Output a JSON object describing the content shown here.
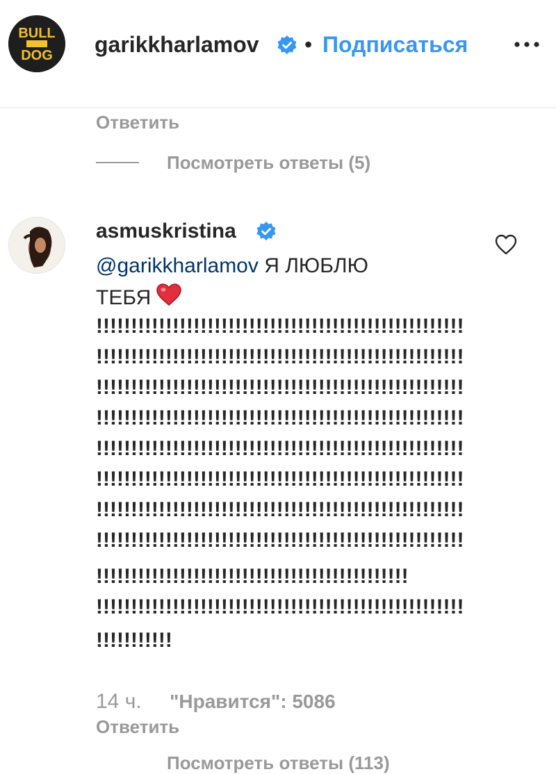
{
  "header": {
    "username": "garikkharlamov",
    "separator": "•",
    "follow_label": "Подписаться",
    "avatar_text": "BULL DOG",
    "verified": true
  },
  "feed": {
    "prev_reply_label": "Ответить",
    "prev_view_replies": "Посмотреть ответы (5)",
    "comment": {
      "author": "asmuskristina",
      "verified": true,
      "mention": "@garikkharlamov",
      "text_line1": " Я ЛЮБЛЮ",
      "text_line2": "ТЕБЯ",
      "excl_lines": [
        "!!!!!!!!!!!!!!!!!!!!!!!!!!!!!!!!!!!!!!!!!!!!!!!!!!!!!",
        "!!!!!!!!!!!!!!!!!!!!!!!!!!!!!!!!!!!!!!!!!!!!!!!!!!!!!",
        "!!!!!!!!!!!!!!!!!!!!!!!!!!!!!!!!!!!!!!!!!!!!!!!!!!!!!",
        "!!!!!!!!!!!!!!!!!!!!!!!!!!!!!!!!!!!!!!!!!!!!!!!!!!!!!",
        "!!!!!!!!!!!!!!!!!!!!!!!!!!!!!!!!!!!!!!!!!!!!!!!!!!!!!",
        "!!!!!!!!!!!!!!!!!!!!!!!!!!!!!!!!!!!!!!!!!!!!!!!!!!!!!",
        "!!!!!!!!!!!!!!!!!!!!!!!!!!!!!!!!!!!!!!!!!!!!!!!!!!!!!",
        "!!!!!!!!!!!!!!!!!!!!!!!!!!!!!!!!!!!!!!!!!!!!!!!!!!!!!",
        "!!!!!!!!!!!!!!!!!!!!!!!!!!!!!!!!!!!!!!!!!!!!!",
        "!!!!!!!!!!!!!!!!!!!!!!!!!!!!!!!!!!!!!!!!!!!!!!!!!!!!!",
        "!!!!!!!!!!!"
      ],
      "time": "14 ч.",
      "likes": "\"Нравится\": 5086",
      "reply_label": "Ответить",
      "view_replies": "Посмотреть ответы (113)"
    }
  },
  "colors": {
    "link_blue": "#3897f0",
    "mention_blue": "#003569",
    "muted": "#999999",
    "text": "#262626",
    "heart_red": "#ed4956",
    "verified_blue": "#3897f0"
  },
  "icons": {
    "verified": "verified-badge-icon",
    "more": "more-options-icon",
    "like": "heart-outline-icon",
    "emoji": "red-heart-emoji"
  }
}
